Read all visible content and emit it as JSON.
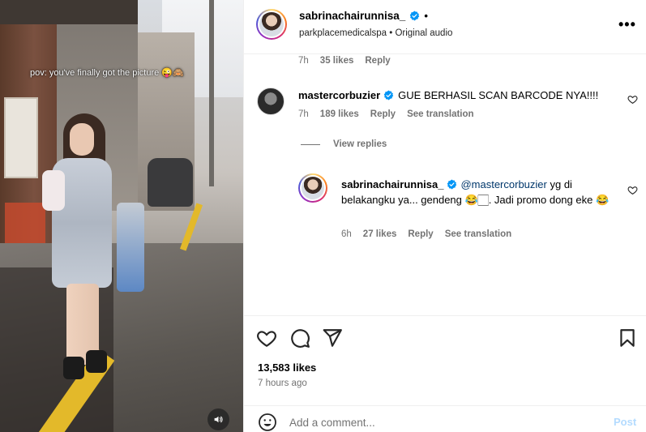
{
  "video": {
    "overlay_caption": "pov: you've finally got the picture 😜🙈",
    "mute_icon": "speaker-icon"
  },
  "header": {
    "username": "sabrinachairunnisa_",
    "dot": "•",
    "subtitle": "parkplacemedicalspa • Original audio",
    "more": "•••"
  },
  "comments": [
    {
      "meta": {
        "time": "7h",
        "likes": "35 likes",
        "reply": "Reply"
      }
    },
    {
      "username": "mastercorbuzier",
      "text": "GUE BERHASIL SCAN BARCODE NYA!!!!",
      "meta": {
        "time": "7h",
        "likes": "189 likes",
        "reply": "Reply",
        "translate": "See translation"
      },
      "view_replies": "View replies"
    },
    {
      "username": "sabrinachairunnisa_",
      "mention": "@mastercorbuzier",
      "text": " yg di belakangku ya... gendeng 😂🏻. Jadi promo dong eke 😂",
      "meta": {
        "time": "6h",
        "likes": "27 likes",
        "reply": "Reply",
        "translate": "See translation"
      }
    }
  ],
  "actions": {
    "likes": "13,583 likes",
    "time_ago": "7 hours ago"
  },
  "add_comment": {
    "placeholder": "Add a comment...",
    "post": "Post"
  },
  "colors": {
    "verified": "#0095f6",
    "mention": "#00376b",
    "post_disabled": "#b3dbff",
    "secondary_text": "#737373"
  }
}
